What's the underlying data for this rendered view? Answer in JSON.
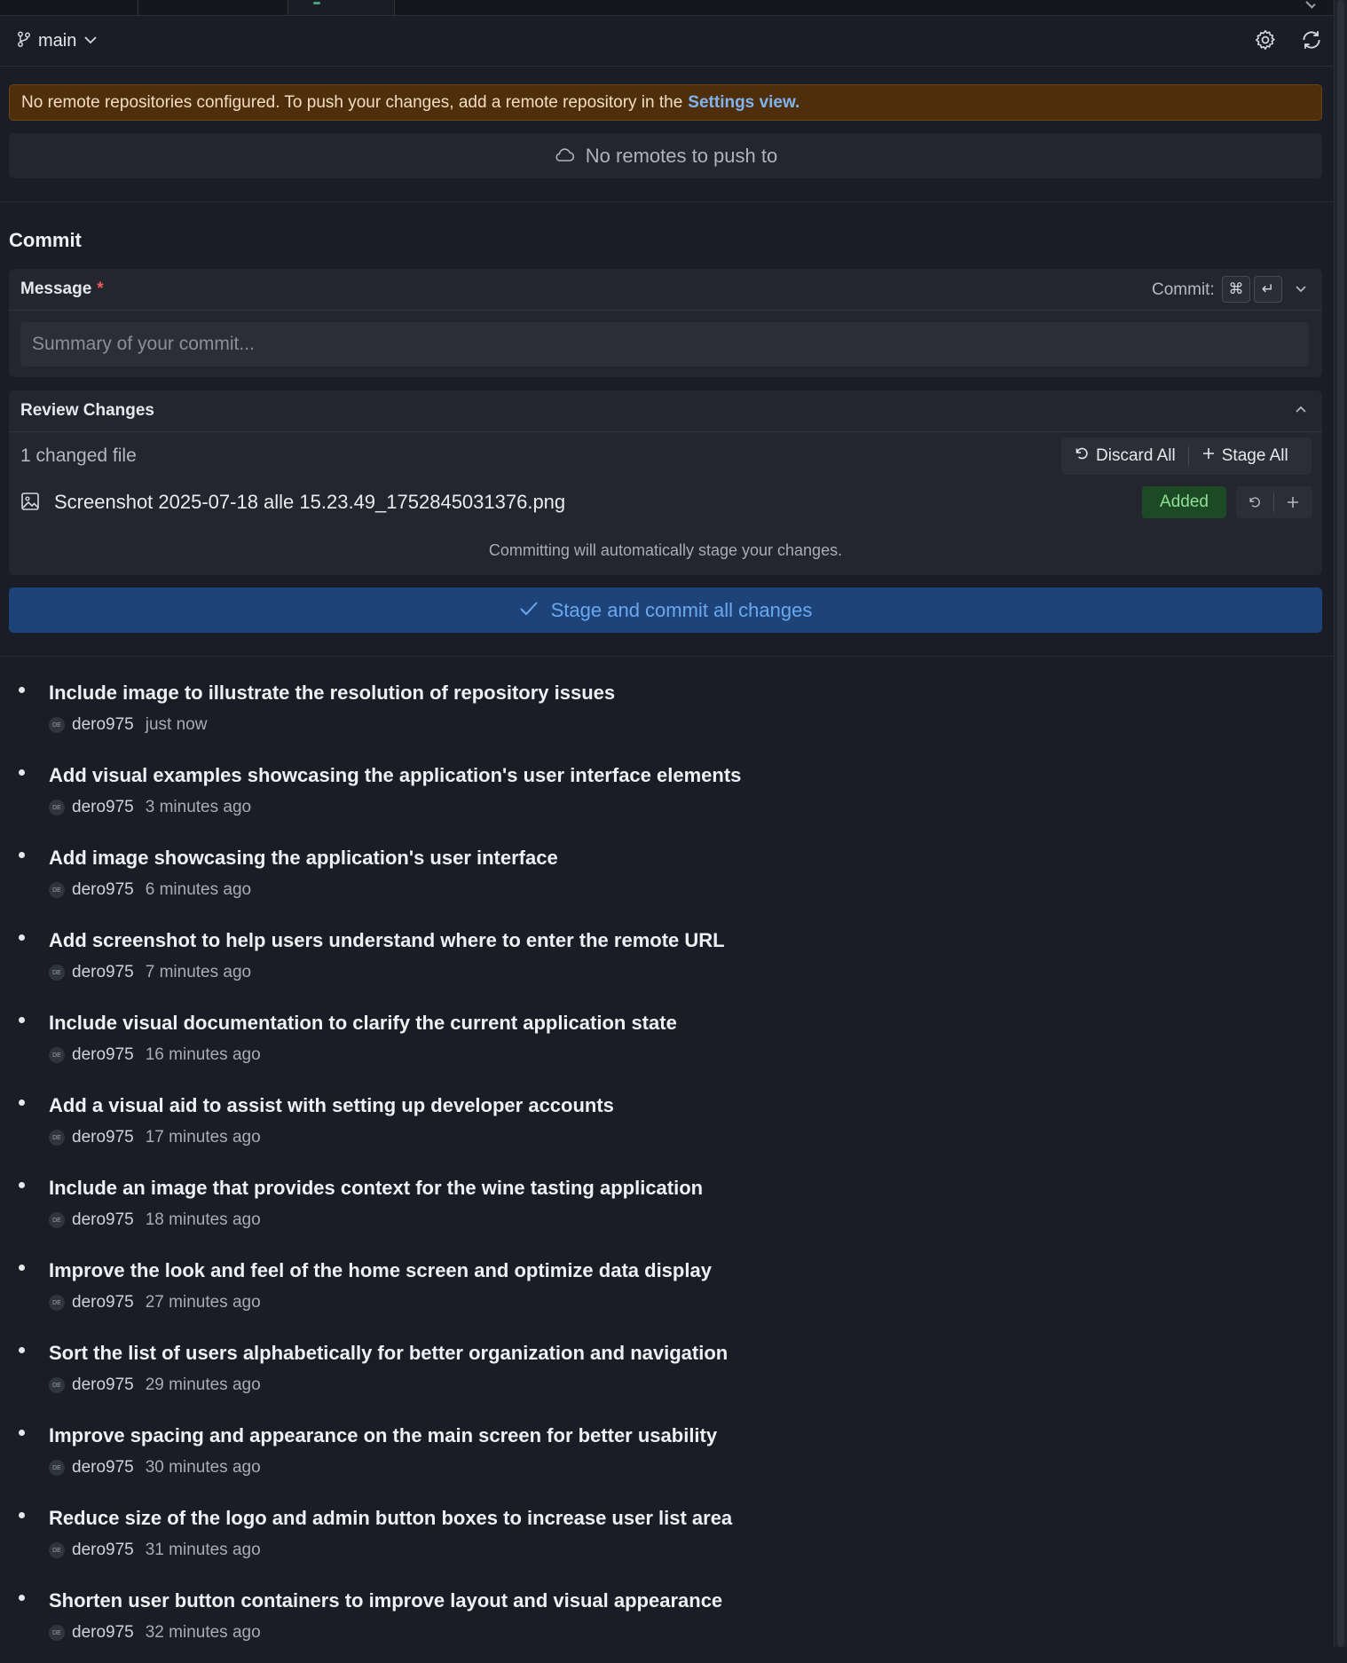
{
  "branch": {
    "name": "main"
  },
  "warning": {
    "text": "No remote repositories configured. To push your changes, add a remote repository in the",
    "link": "Settings view."
  },
  "push": {
    "label": "No remotes to push to"
  },
  "commit": {
    "section_title": "Commit",
    "message_label": "Message",
    "required_mark": "*",
    "shortcut_label": "Commit:",
    "shortcut_keys": [
      "⌘",
      "↵"
    ],
    "placeholder": "Summary of your commit..."
  },
  "review": {
    "title": "Review Changes",
    "changed_count": "1 changed file",
    "discard_all": "Discard All",
    "stage_all": "Stage All",
    "file": {
      "name": "Screenshot 2025-07-18 alle 15.23.49_1752845031376.png",
      "status": "Added"
    },
    "note": "Committing will automatically stage your changes."
  },
  "primary_button": "Stage and commit all changes",
  "history": [
    {
      "title": "Include image to illustrate the resolution of repository issues",
      "avatar": "DE",
      "author": "dero975",
      "time": "just now"
    },
    {
      "title": "Add visual examples showcasing the application's user interface elements",
      "avatar": "DE",
      "author": "dero975",
      "time": "3 minutes ago"
    },
    {
      "title": "Add image showcasing the application's user interface",
      "avatar": "DE",
      "author": "dero975",
      "time": "6 minutes ago"
    },
    {
      "title": "Add screenshot to help users understand where to enter the remote URL",
      "avatar": "DE",
      "author": "dero975",
      "time": "7 minutes ago"
    },
    {
      "title": "Include visual documentation to clarify the current application state",
      "avatar": "DE",
      "author": "dero975",
      "time": "16 minutes ago"
    },
    {
      "title": "Add a visual aid to assist with setting up developer accounts",
      "avatar": "DE",
      "author": "dero975",
      "time": "17 minutes ago"
    },
    {
      "title": "Include an image that provides context for the wine tasting application",
      "avatar": "DE",
      "author": "dero975",
      "time": "18 minutes ago"
    },
    {
      "title": "Improve the look and feel of the home screen and optimize data display",
      "avatar": "DE",
      "author": "dero975",
      "time": "27 minutes ago"
    },
    {
      "title": "Sort the list of users alphabetically for better organization and navigation",
      "avatar": "DE",
      "author": "dero975",
      "time": "29 minutes ago"
    },
    {
      "title": "Improve spacing and appearance on the main screen for better usability",
      "avatar": "DE",
      "author": "dero975",
      "time": "30 minutes ago"
    },
    {
      "title": "Reduce size of the logo and admin button boxes to increase user list area",
      "avatar": "DE",
      "author": "dero975",
      "time": "31 minutes ago"
    },
    {
      "title": "Shorten user button containers to improve layout and visual appearance",
      "avatar": "DE",
      "author": "dero975",
      "time": "32 minutes ago"
    }
  ]
}
